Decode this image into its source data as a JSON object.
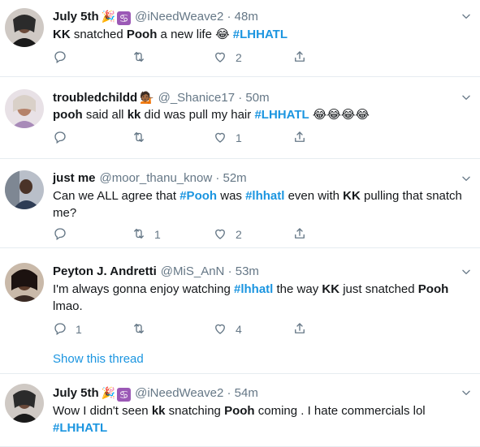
{
  "tweets": [
    {
      "name": "July 5th",
      "name_emoji": "🎉",
      "zodiac": "♋",
      "handle": "@iNeedWeave2",
      "dot": "·",
      "time": "48m",
      "text": [
        {
          "t": "KK",
          "s": "b"
        },
        {
          "t": " snatched "
        },
        {
          "t": "Pooh",
          "s": "b"
        },
        {
          "t": " a new life 😂 "
        },
        {
          "t": "#LHHATL",
          "s": "tag"
        }
      ],
      "replies": "",
      "retweets": "",
      "likes": "2"
    },
    {
      "name": "troubledchildd",
      "name_emoji": "💁🏾",
      "zodiac": "",
      "handle": "@_Shanice17",
      "dot": "·",
      "time": "50m",
      "text": [
        {
          "t": "pooh",
          "s": "b"
        },
        {
          "t": " said all "
        },
        {
          "t": "kk",
          "s": "b"
        },
        {
          "t": " did was pull my hair "
        },
        {
          "t": "#LHHATL",
          "s": "tag"
        },
        {
          "t": " 😂😂😂😂"
        }
      ],
      "replies": "",
      "retweets": "",
      "likes": "1"
    },
    {
      "name": "just me",
      "name_emoji": "",
      "zodiac": "",
      "handle": "@moor_thanu_know",
      "dot": "·",
      "time": "52m",
      "text": [
        {
          "t": "Can we ALL agree that "
        },
        {
          "t": "#Pooh",
          "s": "tag"
        },
        {
          "t": " was "
        },
        {
          "t": "#lhhatl",
          "s": "tag"
        },
        {
          "t": " even with "
        },
        {
          "t": "KK",
          "s": "b"
        },
        {
          "t": " pulling that snatch me?"
        }
      ],
      "replies": "",
      "retweets": "1",
      "likes": "2"
    },
    {
      "name": "Peyton J. Andretti",
      "name_emoji": "",
      "zodiac": "",
      "handle": "@MiS_AnN",
      "dot": "·",
      "time": "53m",
      "text": [
        {
          "t": "I'm always gonna enjoy watching "
        },
        {
          "t": "#lhhatl",
          "s": "tag"
        },
        {
          "t": " the way "
        },
        {
          "t": "KK",
          "s": "b"
        },
        {
          "t": " just snatched "
        },
        {
          "t": "Pooh",
          "s": "b"
        },
        {
          "t": " lmao."
        }
      ],
      "replies": "1",
      "retweets": "",
      "likes": "4",
      "show_thread": "Show this thread"
    },
    {
      "name": "July 5th",
      "name_emoji": "🎉",
      "zodiac": "♋",
      "handle": "@iNeedWeave2",
      "dot": "·",
      "time": "54m",
      "text": [
        {
          "t": "Wow I didn't seen "
        },
        {
          "t": "kk",
          "s": "b"
        },
        {
          "t": " snatching "
        },
        {
          "t": "Pooh",
          "s": "b"
        },
        {
          "t": " coming . I hate commercials lol "
        },
        {
          "t": "#LHHATL",
          "s": "tag"
        }
      ],
      "replies": "",
      "retweets": "",
      "likes": ""
    }
  ],
  "colors": {
    "text": "#14171a",
    "muted": "#657786",
    "link": "#1b95e0",
    "divider": "#e6ecf0"
  },
  "icons": [
    "reply-icon",
    "retweet-icon",
    "like-icon",
    "share-icon",
    "chevron-down-icon"
  ]
}
